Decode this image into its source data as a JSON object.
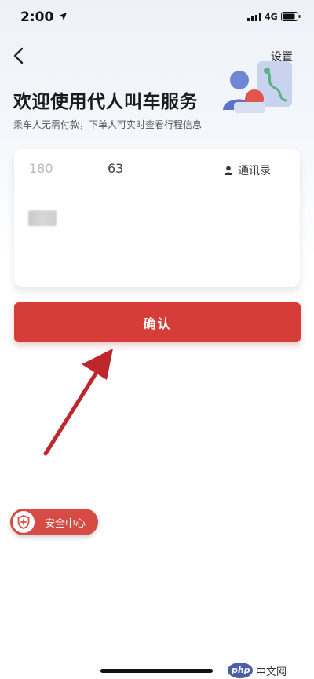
{
  "status_bar": {
    "time": "2:00",
    "network": "4G",
    "icons": [
      "location-arrow-icon",
      "signal-bars-icon",
      "battery-icon"
    ]
  },
  "nav": {
    "back_icon": "chevron-left-icon",
    "settings_label": "设置"
  },
  "header": {
    "title": "欢迎使用代人叫车服务",
    "subtitle": "乘车人无需付款，下单人可实时查看行程信息",
    "illustration_icon": "rider-map-illustration"
  },
  "form": {
    "phone_prefix_visible": "180",
    "phone_suffix_visible": "63",
    "contacts_label": "通讯录",
    "contacts_icon": "person-icon"
  },
  "confirm_label": "确认",
  "safety_center": {
    "label": "安全中心",
    "icon": "shield-plus-icon"
  },
  "watermark": {
    "logo_text": "php",
    "text": "中文网"
  },
  "colors": {
    "accent_red": "#d63d38",
    "safety_red": "#d74b45",
    "arrow_red": "#c0272d"
  }
}
